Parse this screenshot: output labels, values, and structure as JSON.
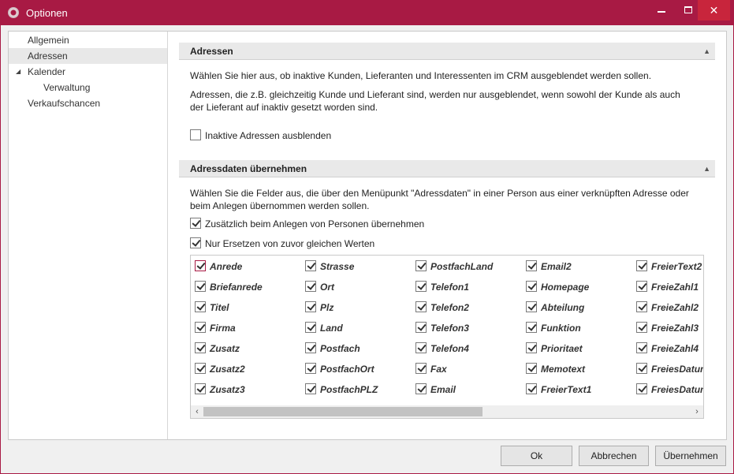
{
  "window": {
    "title": "Optionen",
    "accent": "#a81a44",
    "icons": [
      "app-icon",
      "minimize-icon",
      "maximize-icon",
      "close-icon"
    ]
  },
  "nav": {
    "items": [
      {
        "label": "Allgemein"
      },
      {
        "label": "Adressen"
      },
      {
        "label": "Kalender"
      },
      {
        "label": "Verwaltung"
      },
      {
        "label": "Verkaufschancen"
      }
    ]
  },
  "section1": {
    "title": "Adressen",
    "text1": "Wählen Sie hier aus, ob inaktive Kunden, Lieferanten und Interessenten im CRM ausgeblendet werden sollen.",
    "text2": "Adressen, die z.B. gleichzeitig Kunde und Lieferant sind, werden nur ausgeblendet, wenn sowohl der Kunde als auch der Lieferant auf inaktiv gesetzt worden sind.",
    "checkbox_label": "Inaktive Adressen ausblenden"
  },
  "section2": {
    "title": "Adressdaten übernehmen",
    "text": "Wählen Sie die Felder aus, die über den Menüpunkt \"Adressdaten\" in einer Person aus einer verknüpften Adresse oder beim Anlegen übernommen werden sollen.",
    "option1": "Zusätzlich beim Anlegen von Personen übernehmen",
    "option2": "Nur Ersetzen von zuvor gleichen Werten",
    "columns": [
      [
        "Anrede",
        "Briefanrede",
        "Titel",
        "Firma",
        "Zusatz",
        "Zusatz2",
        "Zusatz3"
      ],
      [
        "Strasse",
        "Ort",
        "Plz",
        "Land",
        "Postfach",
        "PostfachOrt",
        "PostfachPLZ"
      ],
      [
        "PostfachLand",
        "Telefon1",
        "Telefon2",
        "Telefon3",
        "Telefon4",
        "Fax",
        "Email"
      ],
      [
        "Email2",
        "Homepage",
        "Abteilung",
        "Funktion",
        "Prioritaet",
        "Memotext",
        "FreierText1"
      ],
      [
        "FreierText2",
        "FreieZahl1",
        "FreieZahl2",
        "FreieZahl3",
        "FreieZahl4",
        "FreiesDatum",
        "FreiesDatum"
      ]
    ]
  },
  "buttons": {
    "ok": "Ok",
    "cancel": "Abbrechen",
    "apply": "Übernehmen"
  }
}
